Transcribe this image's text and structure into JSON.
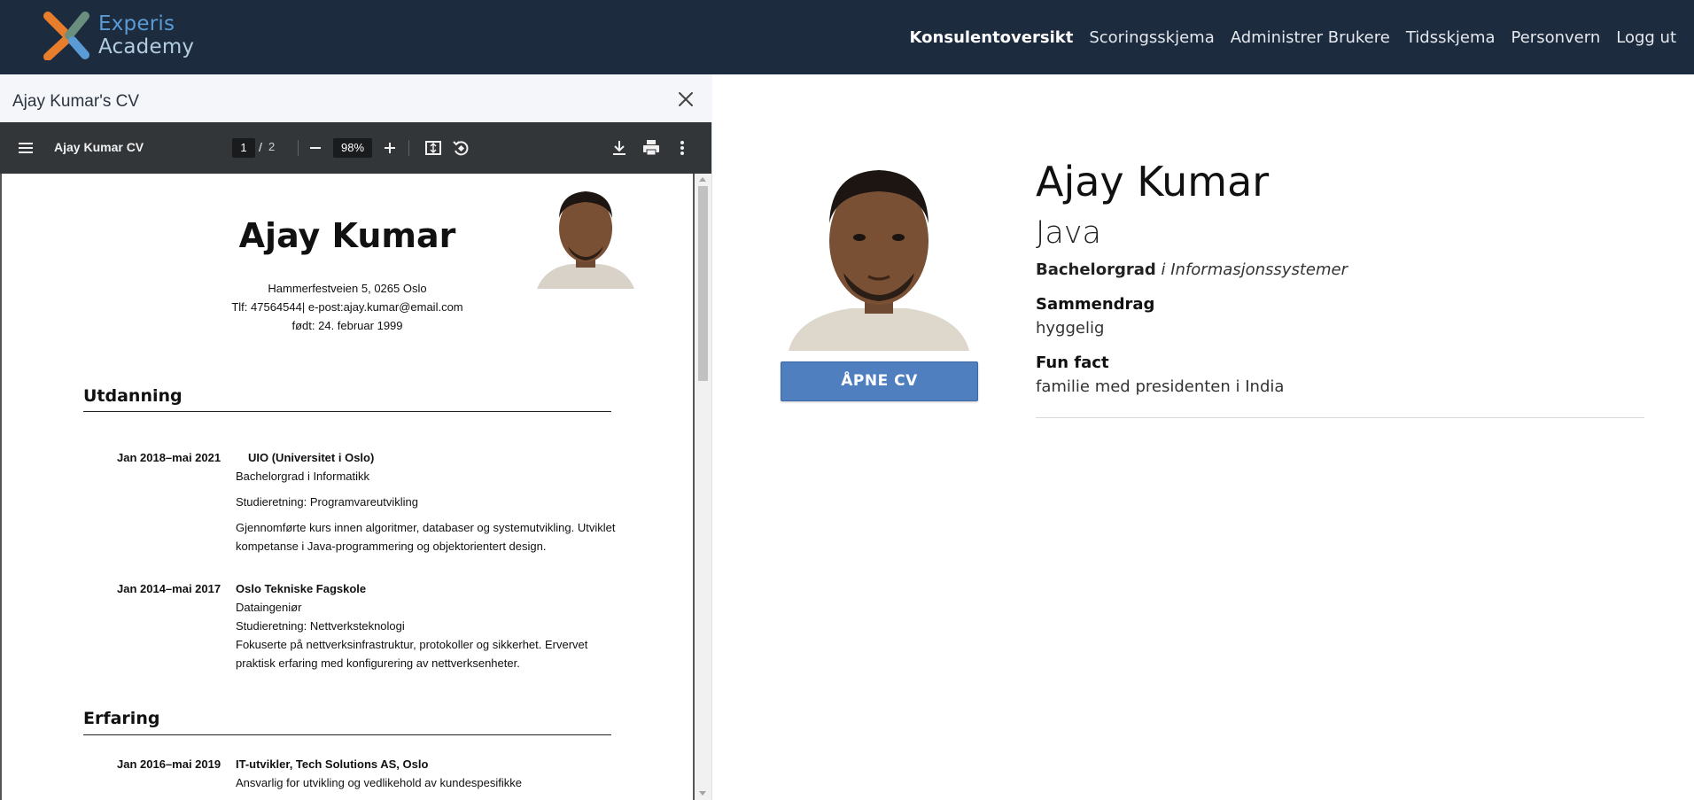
{
  "brand": {
    "line1": "Experis",
    "line2": "Academy"
  },
  "nav": {
    "items": [
      {
        "label": "Konsulentoversikt",
        "active": true
      },
      {
        "label": "Scoringsskjema",
        "active": false
      },
      {
        "label": "Administrer Brukere",
        "active": false
      },
      {
        "label": "Tidsskjema",
        "active": false
      },
      {
        "label": "Personvern",
        "active": false
      },
      {
        "label": "Logg ut",
        "active": false
      }
    ]
  },
  "cv_panel": {
    "title": "Ajay Kumar's CV",
    "toolbar": {
      "doc_title": "Ajay Kumar CV",
      "page_current": "1",
      "page_sep": "/",
      "page_total": "2",
      "zoom": "98%"
    },
    "document": {
      "name": "Ajay Kumar",
      "address": "Hammerfestveien 5, 0265 Oslo",
      "contact": "Tlf: 47564544| e-post:ajay.kumar@email.com",
      "born": "født: 24. februar 1999",
      "education_heading": "Utdanning",
      "education": [
        {
          "date": "Jan 2018–mai 2021",
          "institution": "UIO (Universitet i Oslo)",
          "degree": "Bachelorgrad i Informatikk",
          "field": "Studieretning: Programvareutvikling",
          "desc": "Gjennomførte kurs innen algoritmer, databaser og systemutvikling. Utviklet kompetanse i Java-programmering og objektorientert design."
        },
        {
          "date": "Jan 2014–mai 2017",
          "institution": "Oslo Tekniske Fagskole",
          "degree": "Dataingeniør",
          "field": "Studieretning: Nettverksteknologi",
          "desc": "Fokuserte på nettverksinfrastruktur, protokoller og sikkerhet. Ervervet praktisk erfaring med konfigurering av nettverksenheter."
        }
      ],
      "experience_heading": "Erfaring",
      "experience": [
        {
          "date": "Jan 2016–mai 2019",
          "title": "IT-utvikler, Tech Solutions AS, Oslo",
          "desc": "Ansvarlig for utvikling og vedlikehold av kundespesifikke"
        }
      ]
    }
  },
  "profile": {
    "name": "Ajay Kumar",
    "language": "Java",
    "degree_level": "Bachelorgrad",
    "degree_field": "i Informasjonssystemer",
    "summary_label": "Sammendrag",
    "summary": "hyggelig",
    "funfact_label": "Fun fact",
    "funfact": "familie med presidenten i India",
    "open_cv_label": "ÅPNE CV"
  },
  "colors": {
    "navbar": "#1c2b3e",
    "accent_button": "#4f7fbf",
    "logo_orange": "#e87d2c",
    "logo_blue": "#5a9bd5",
    "logo_green": "#6a8f7e",
    "pdf_toolbar": "#323639"
  },
  "icons": [
    "menu-icon",
    "minus-icon",
    "plus-icon",
    "fit-page-icon",
    "rotate-icon",
    "download-icon",
    "print-icon",
    "more-vert-icon",
    "close-icon"
  ]
}
